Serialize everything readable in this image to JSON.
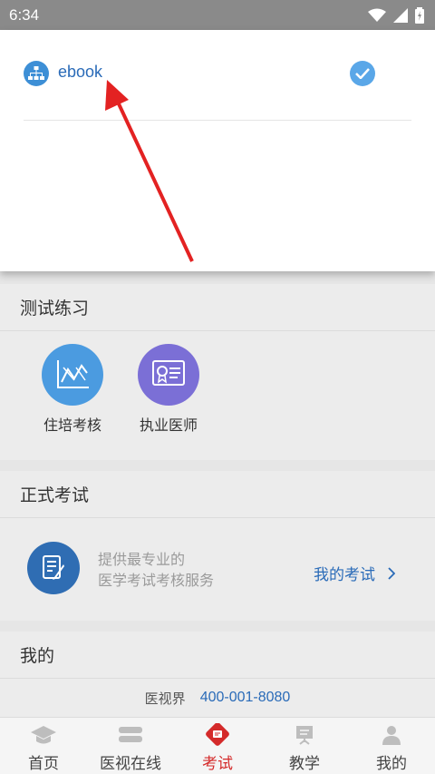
{
  "status_bar": {
    "time": "6:34"
  },
  "dropdown": {
    "items": [
      {
        "label": "ebook",
        "selected": true
      }
    ]
  },
  "sections": {
    "practice": {
      "title": "测试练习",
      "tiles": [
        {
          "label": "住培考核",
          "icon": "chart-icon",
          "color": "#4b9be0"
        },
        {
          "label": "执业医师",
          "icon": "certificate-icon",
          "color": "#7b6fd6"
        }
      ]
    },
    "formal_exam": {
      "title": "正式考试",
      "desc_line1": "提供最专业的",
      "desc_line2": "医学考试考核服务",
      "my_exam": "我的考试"
    },
    "mine": {
      "title": "我的",
      "org": "医视界",
      "phone": "400-001-8080"
    }
  },
  "tabbar": {
    "tabs": [
      {
        "label": "首页",
        "icon": "graduation-cap-icon"
      },
      {
        "label": "医视在线",
        "icon": "stack-icon"
      },
      {
        "label": "考试",
        "icon": "exam-icon",
        "active": true
      },
      {
        "label": "教学",
        "icon": "board-icon"
      },
      {
        "label": "我的",
        "icon": "person-icon"
      }
    ]
  },
  "colors": {
    "accent_blue": "#2a6bb8",
    "active_red": "#d42a2a",
    "status_bar": "#8a8a8a"
  }
}
